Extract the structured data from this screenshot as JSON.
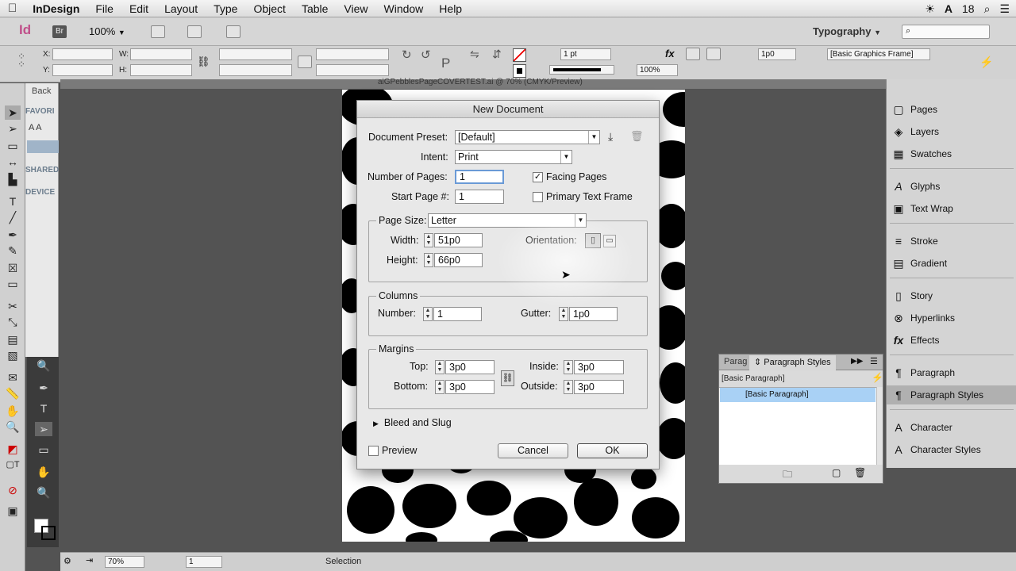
{
  "menubar": {
    "app": "InDesign",
    "items": [
      "File",
      "Edit",
      "Layout",
      "Type",
      "Object",
      "Table",
      "View",
      "Window",
      "Help"
    ],
    "status_right": "18"
  },
  "appbar": {
    "logo": "Id",
    "bridge": "Br",
    "zoom": "100%",
    "workspace": "Typography",
    "search_placeholder": ""
  },
  "control": {
    "x_label": "X:",
    "y_label": "Y:",
    "w_label": "W:",
    "h_label": "H:",
    "stroke_weight": "1 pt",
    "opacity": "100%",
    "ref_value": "1p0",
    "object_style": "[Basic Graphics Frame]"
  },
  "bridge_panel": {
    "back": "Back",
    "favorites": "FAVORI",
    "shared": "SHARED",
    "devices": "DEVICE"
  },
  "doc_title": "aiGPebblesPageCOVERTEST.ai @ 70% (CMYK/Preview)",
  "dialog": {
    "title": "New Document",
    "preset_label": "Document Preset:",
    "preset_value": "[Default]",
    "intent_label": "Intent:",
    "intent_value": "Print",
    "num_pages_label": "Number of Pages:",
    "num_pages_value": "1",
    "start_page_label": "Start Page #:",
    "start_page_value": "1",
    "facing_pages_label": "Facing Pages",
    "facing_pages_checked": true,
    "primary_text_label": "Primary Text Frame",
    "primary_text_checked": false,
    "page_size_label": "Page Size:",
    "page_size_value": "Letter",
    "width_label": "Width:",
    "width_value": "51p0",
    "height_label": "Height:",
    "height_value": "66p0",
    "orientation_label": "Orientation:",
    "columns_title": "Columns",
    "number_label": "Number:",
    "number_value": "1",
    "gutter_label": "Gutter:",
    "gutter_value": "1p0",
    "margins_title": "Margins",
    "top_label": "Top:",
    "top_value": "3p0",
    "bottom_label": "Bottom:",
    "bottom_value": "3p0",
    "inside_label": "Inside:",
    "inside_value": "3p0",
    "outside_label": "Outside:",
    "outside_value": "3p0",
    "bleed_label": "Bleed and Slug",
    "preview_label": "Preview",
    "cancel_label": "Cancel",
    "ok_label": "OK"
  },
  "right_panel": {
    "items": [
      {
        "label": "Pages",
        "icon": "pages-icon",
        "glyph": "▢"
      },
      {
        "label": "Layers",
        "icon": "layers-icon",
        "glyph": "◈"
      },
      {
        "label": "Swatches",
        "icon": "swatches-icon",
        "glyph": "▦"
      },
      {
        "label": "Glyphs",
        "icon": "glyphs-icon",
        "glyph": "A"
      },
      {
        "label": "Text Wrap",
        "icon": "text-wrap-icon",
        "glyph": "▣"
      },
      {
        "label": "Stroke",
        "icon": "stroke-icon",
        "glyph": "≡"
      },
      {
        "label": "Gradient",
        "icon": "gradient-icon",
        "glyph": "▤"
      },
      {
        "label": "Story",
        "icon": "story-icon",
        "glyph": "▯"
      },
      {
        "label": "Hyperlinks",
        "icon": "hyperlinks-icon",
        "glyph": "⊗"
      },
      {
        "label": "Effects",
        "icon": "effects-icon",
        "glyph": "fx"
      },
      {
        "label": "Paragraph",
        "icon": "paragraph-icon",
        "glyph": "¶"
      },
      {
        "label": "Paragraph Styles",
        "icon": "paragraph-styles-icon",
        "glyph": "¶"
      },
      {
        "label": "Character",
        "icon": "character-icon",
        "glyph": "A"
      },
      {
        "label": "Character Styles",
        "icon": "character-styles-icon",
        "glyph": "A"
      }
    ]
  },
  "para_panel": {
    "tab1": "Parag",
    "tab2": "Paragraph Styles",
    "current": "[Basic Paragraph]",
    "row": "[Basic Paragraph]"
  },
  "statusbar": {
    "zoom": "70%",
    "page": "1",
    "mode": "Selection"
  },
  "colors": {
    "pasteboard": "#535353",
    "selection_row": "#a9d1f5"
  }
}
